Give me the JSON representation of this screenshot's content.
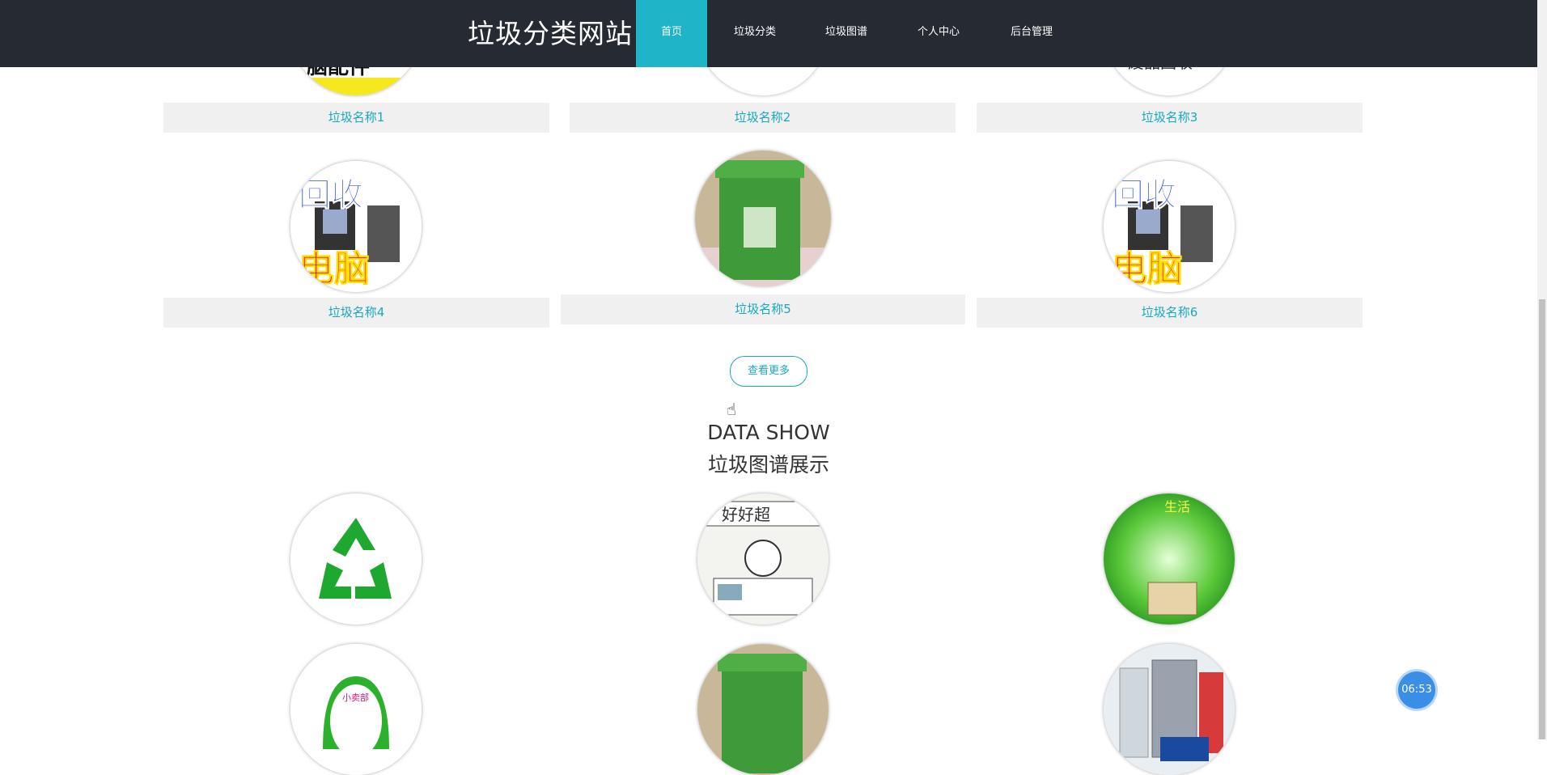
{
  "site": {
    "brand": "垃圾分类网站"
  },
  "nav": [
    {
      "label": "首页",
      "active": true
    },
    {
      "label": "垃圾分类",
      "active": false
    },
    {
      "label": "垃圾图谱",
      "active": false
    },
    {
      "label": "个人中心",
      "active": false
    },
    {
      "label": "后台管理",
      "active": false
    }
  ],
  "items": [
    {
      "name": "垃圾名称1"
    },
    {
      "name": "垃圾名称2"
    },
    {
      "name": "垃圾名称3"
    },
    {
      "name": "垃圾名称4"
    },
    {
      "name": "垃圾名称5"
    },
    {
      "name": "垃圾名称6"
    }
  ],
  "more_label": "查看更多",
  "section": {
    "title_en": "DATA SHOW",
    "title_cn": "垃圾图谱展示"
  },
  "timer": "06:53",
  "colors": {
    "accent": "#1fb5c8",
    "nav_bg": "#252a33"
  }
}
